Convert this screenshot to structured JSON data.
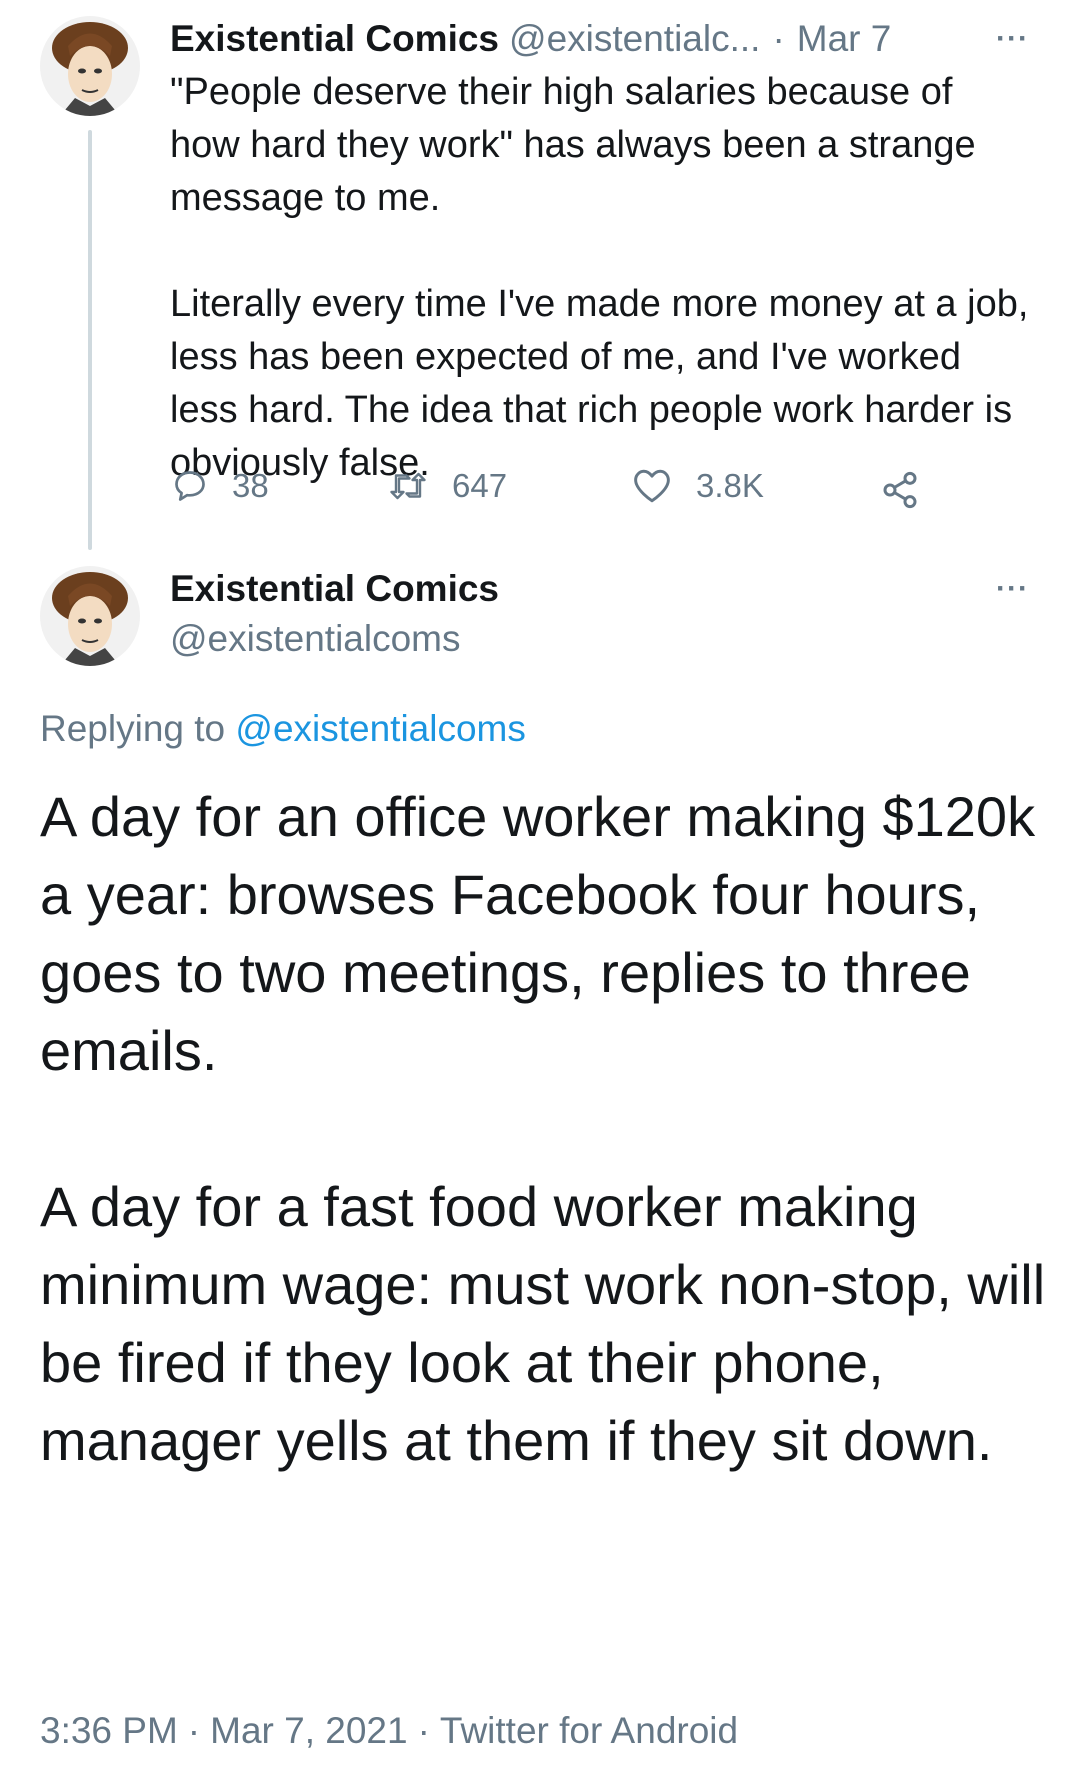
{
  "tweet1": {
    "avatar": "avatar-illustration",
    "name": "Existential Comics",
    "handle": "@existentialc...",
    "dot": "·",
    "date": "Mar 7",
    "more": "···",
    "text": "\"People deserve their high salaries because of how hard they work\" has always been a strange message to me.\n\nLiterally every time I've made more money at a job, less has been expected of me, and I've worked less hard. The idea that rich people work harder is obviously false.",
    "actions": {
      "replies": "38",
      "retweets": "647",
      "likes": "3.8K"
    }
  },
  "tweet2": {
    "avatar": "avatar-illustration",
    "name": "Existential Comics",
    "handle": "@existentialcoms",
    "more": "···",
    "replying_prefix": "Replying to",
    "replying_to": "@existentialcoms",
    "text": "A day for an office worker making $120k a year: browses Facebook four hours, goes to two meetings, replies to three emails.\n\nA day for a fast food worker making minimum wage: must work non-stop, will be fired if they look at their phone, manager yells at them if they sit down.",
    "time": "3:36 PM",
    "sep": "·",
    "date": "Mar 7, 2021",
    "client": "Twitter for Android"
  },
  "colors": {
    "text": "#14171a",
    "muted": "#657786",
    "link": "#1b95e0",
    "thread_line": "#cfd9de"
  }
}
